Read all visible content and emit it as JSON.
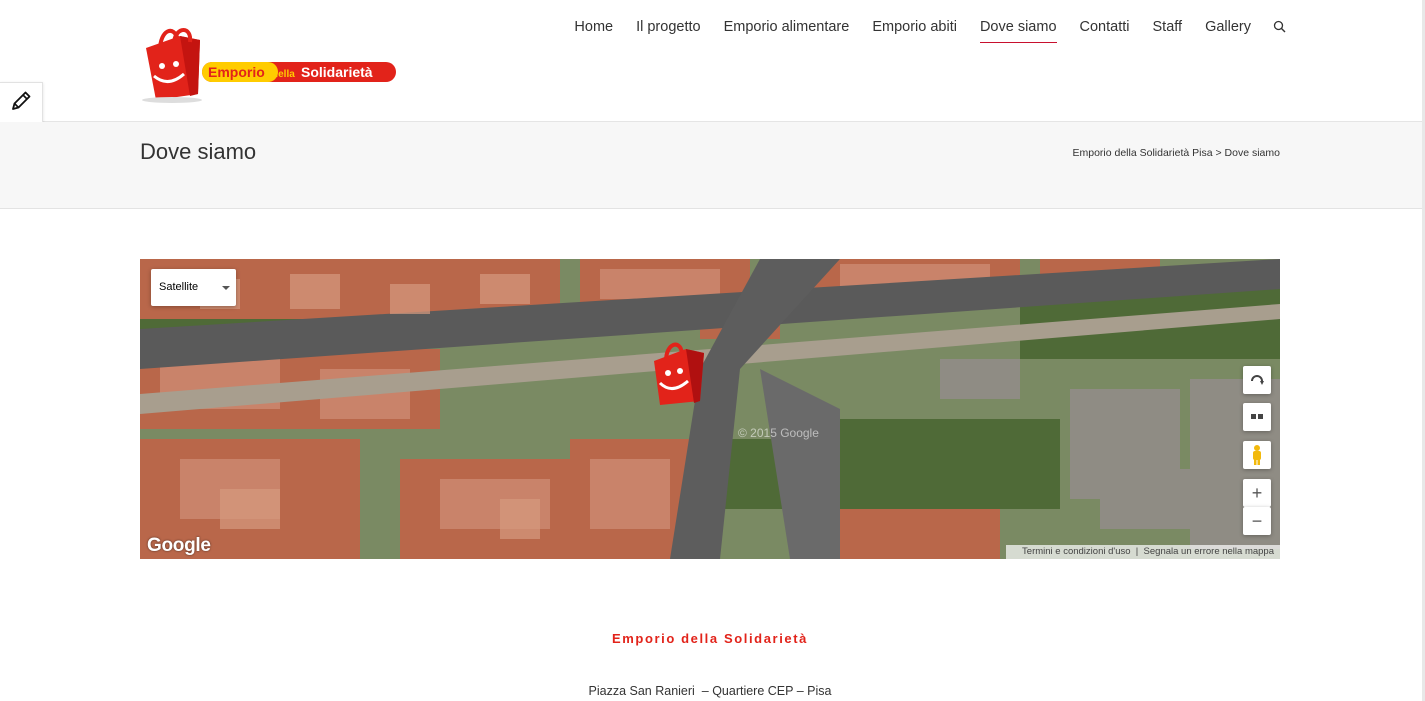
{
  "logo": {
    "text_main": "Emporio",
    "text_della": "della",
    "text_solidarieta": "Solidarietà"
  },
  "nav": {
    "items": [
      "Home",
      "Il progetto",
      "Emporio alimentare",
      "Emporio abiti",
      "Dove siamo",
      "Contatti",
      "Staff",
      "Gallery"
    ],
    "active": "Dove siamo",
    "search_icon": "search-icon"
  },
  "page": {
    "title": "Dove siamo",
    "breadcrumb": {
      "home": "Emporio della Solidarietà Pisa",
      "separator": ">",
      "current": "Dove siamo"
    }
  },
  "map": {
    "type_selected": "Satellite",
    "copyright": "© 2015 Google",
    "attribution": "Google",
    "footer_terms": "Termini e condizioni d'uso",
    "footer_report": "Segnala un errore nella mappa",
    "controls": [
      "rotate-icon",
      "tilt-icon",
      "pegman-icon",
      "zoom-in-icon",
      "zoom-out-icon"
    ],
    "zoom_in": "+",
    "zoom_out": "−"
  },
  "content": {
    "org_name": "Emporio della Solidarietà",
    "address": "Piazza San Ranieri  – Quartiere CEP – Pisa"
  },
  "colors": {
    "accent": "#c8102e",
    "brand_red": "#e2231a",
    "brand_yellow": "#ffcc00"
  }
}
